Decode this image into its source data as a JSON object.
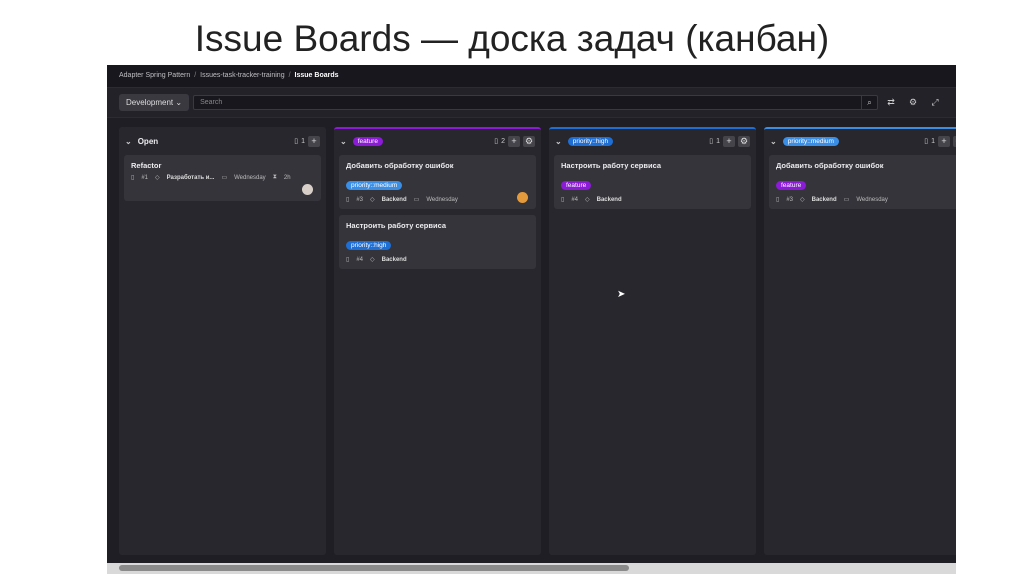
{
  "slide": {
    "title": "Issue Boards — доска задач (канбан)"
  },
  "breadcrumb": [
    "Adapter Spring Pattern",
    "Issues-task-tracker-training",
    "Issue Boards"
  ],
  "toolbar": {
    "board": "Development",
    "search_placeholder": "Search"
  },
  "colors": {
    "feature": "#8b1bd6",
    "priority_high": "#1f6ed4",
    "priority_medium": "#3b8ee6"
  },
  "columns": [
    {
      "title": "Open",
      "count": "1",
      "cards": [
        {
          "title": "Refactor",
          "id": "#1",
          "milestone": "Разработать и...",
          "due": "Wednesday",
          "time": "2h"
        }
      ]
    },
    {
      "title": "feature",
      "count": "2",
      "cards": [
        {
          "title": "Добавить обработку ошибок",
          "label": "priority::medium",
          "id": "#3",
          "milestone": "Backend",
          "due": "Wednesday"
        },
        {
          "title": "Настроить работу сервиса",
          "label": "priority::high",
          "id": "#4",
          "milestone": "Backend"
        }
      ]
    },
    {
      "title": "priority::high",
      "count": "1",
      "cards": [
        {
          "title": "Настроить работу сервиса",
          "label": "feature",
          "id": "#4",
          "milestone": "Backend"
        }
      ]
    },
    {
      "title": "priority::medium",
      "count": "1",
      "cards": [
        {
          "title": "Добавить обработку ошибок",
          "label": "feature",
          "id": "#3",
          "milestone": "Backend",
          "due": "Wednesday"
        }
      ]
    }
  ]
}
